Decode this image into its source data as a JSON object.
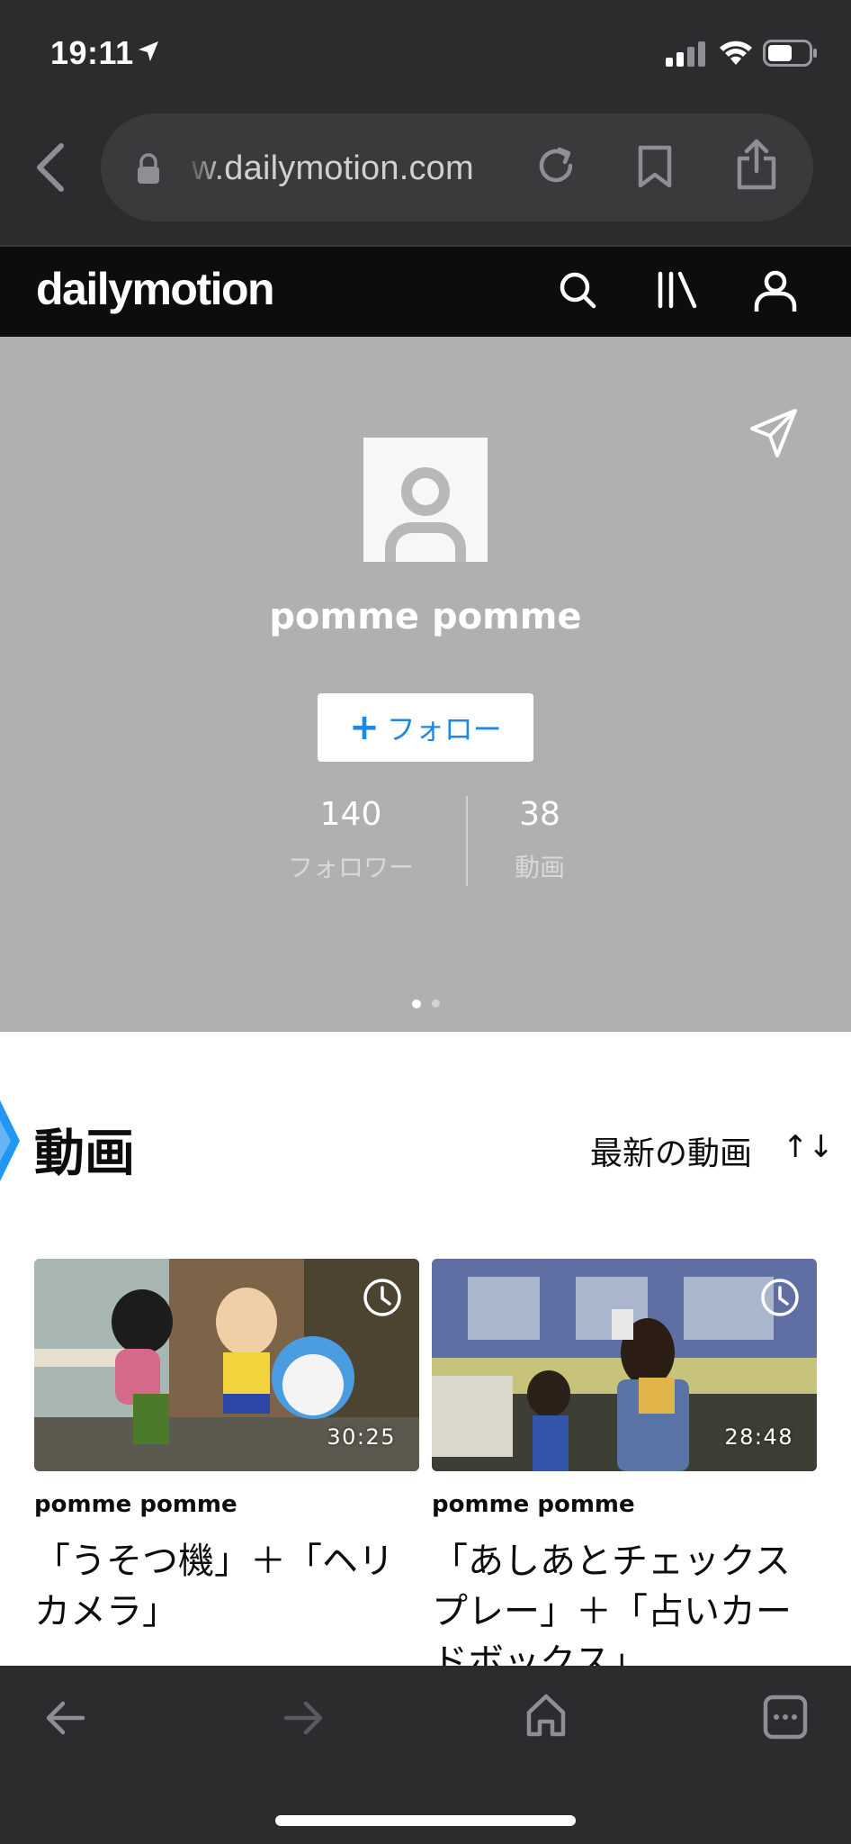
{
  "status_bar": {
    "time": "19:11",
    "icons": [
      "location-arrow-icon",
      "signal-icon",
      "wifi-icon",
      "battery-icon"
    ]
  },
  "browser": {
    "url": "w.dailymotion.com",
    "icons": [
      "back-icon",
      "lock-icon",
      "reload-icon",
      "bookmark-icon",
      "share-icon"
    ]
  },
  "site_header": {
    "logo": "dailymotion",
    "icons": [
      "search-icon",
      "library-icon",
      "account-icon"
    ]
  },
  "profile": {
    "name": "pomme pomme",
    "follow_label": "フォロー",
    "follow_symbol": "+",
    "followers_count": "140",
    "followers_label": "フォロワー",
    "videos_count": "38",
    "videos_label": "動画",
    "carousel": {
      "pages": 2,
      "active": 1
    }
  },
  "videos_section": {
    "title": "動画",
    "sort_label": "最新の動画",
    "sort_icon": "↑↓",
    "items": [
      {
        "duration": "30:25",
        "channel": "pomme pomme",
        "title": "「うそつ機」＋「ヘリカメラ」"
      },
      {
        "duration": "28:48",
        "channel": "pomme pomme",
        "title": "「あしあとチェックスプレー」＋「占いカードボックス」"
      }
    ]
  },
  "bottom_toolbar": {
    "icons": [
      "nav-back-icon",
      "nav-forward-icon",
      "home-icon",
      "tabs-icon"
    ]
  },
  "colors": {
    "browser_chrome": "#2c2c2e",
    "site_header": "#0d0d0d",
    "banner": "#b0b0b0",
    "accent_blue": "#1e88e5"
  }
}
